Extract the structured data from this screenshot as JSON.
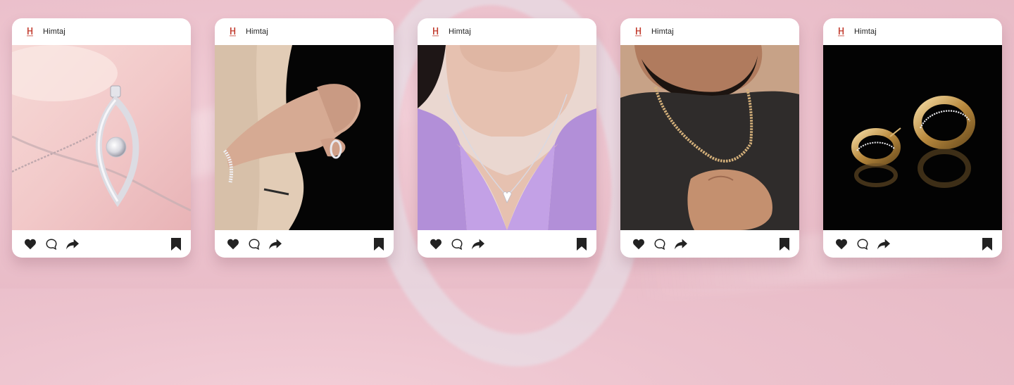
{
  "colors": {
    "accent": "#c0392b",
    "icon": "#222222",
    "background": "#ecc2cd"
  },
  "posts": [
    {
      "account": "Himtaj",
      "photo": "silver teardrop pendant with crystal on chain",
      "icons": [
        "heart-icon",
        "comment-icon",
        "share-icon",
        "bookmark-icon"
      ]
    },
    {
      "account": "Himtaj",
      "photo": "hand wearing tennis bracelet and band ring",
      "icons": [
        "heart-icon",
        "comment-icon",
        "share-icon",
        "bookmark-icon"
      ]
    },
    {
      "account": "Himtaj",
      "photo": "woman wearing heart crystal necklace",
      "icons": [
        "heart-icon",
        "comment-icon",
        "share-icon",
        "bookmark-icon"
      ]
    },
    {
      "account": "Himtaj",
      "photo": "man wearing gold chain",
      "icons": [
        "heart-icon",
        "comment-icon",
        "share-icon",
        "bookmark-icon"
      ]
    },
    {
      "account": "Himtaj",
      "photo": "gold hoop earrings on black",
      "icons": [
        "heart-icon",
        "comment-icon",
        "share-icon",
        "bookmark-icon"
      ]
    }
  ]
}
